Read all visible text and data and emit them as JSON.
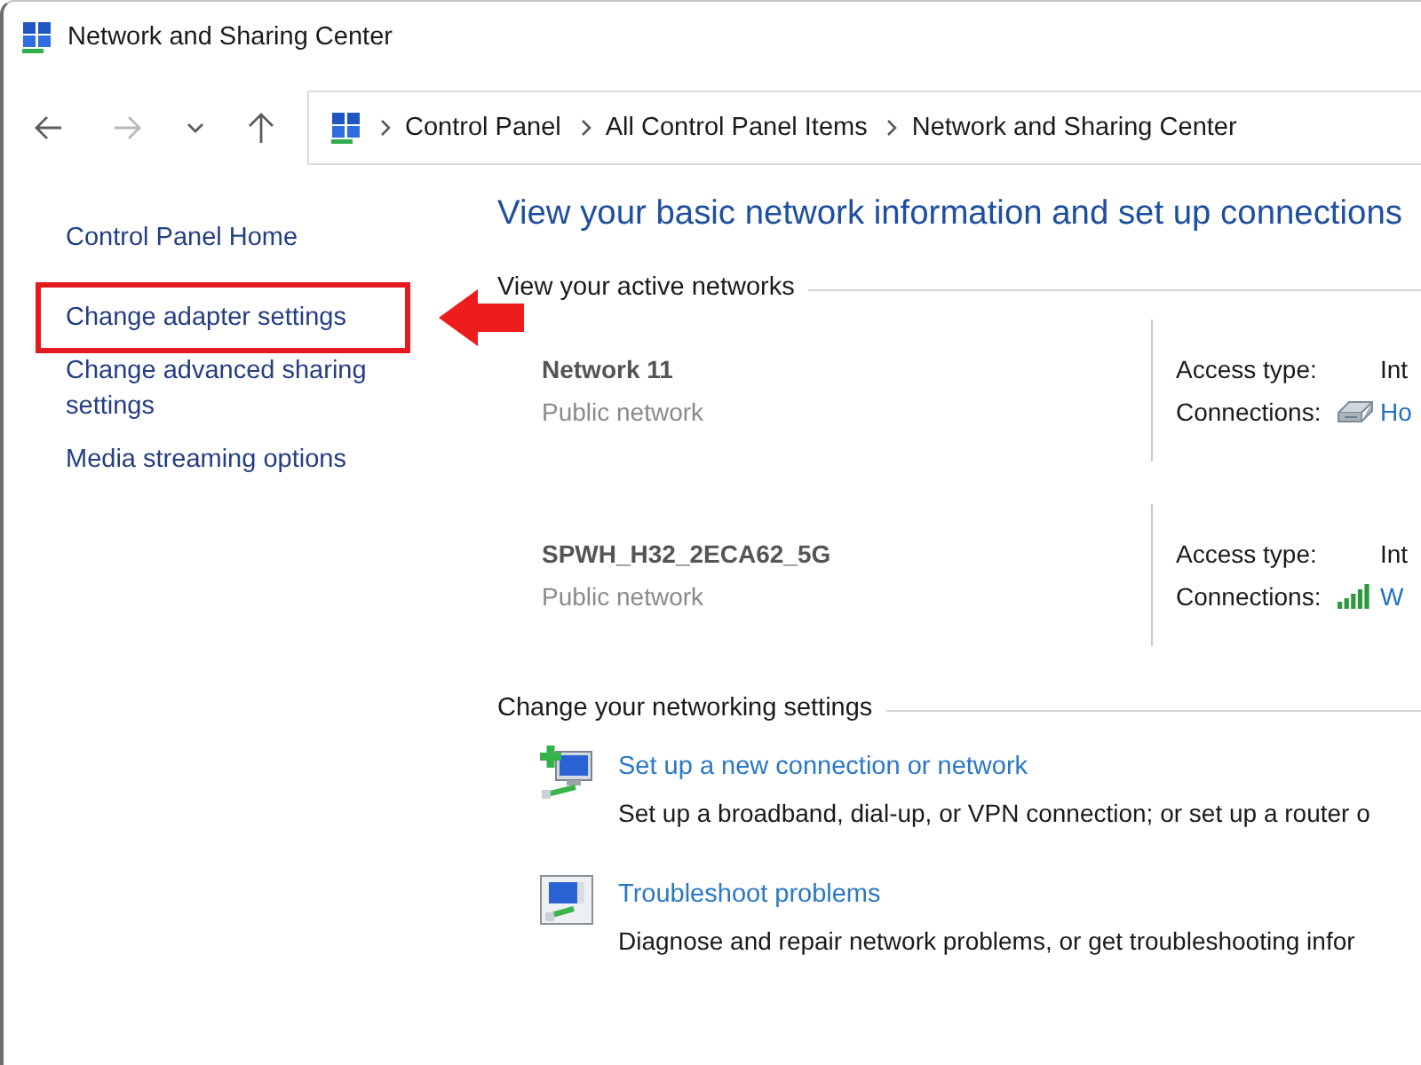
{
  "window": {
    "title": "Network and Sharing Center"
  },
  "navigation": {
    "buttons": [
      {
        "kind": "back",
        "disabled": false
      },
      {
        "kind": "forward",
        "disabled": true
      },
      {
        "kind": "recent",
        "disabled": false
      },
      {
        "kind": "up",
        "disabled": false
      }
    ],
    "breadcrumb": [
      "Control Panel",
      "All Control Panel Items",
      "Network and Sharing Center"
    ]
  },
  "sidebar": {
    "home": "Control Panel Home",
    "items": [
      {
        "label": "Change adapter settings",
        "highlighted": true
      },
      {
        "label": "Change advanced sharing settings",
        "highlighted": false
      },
      {
        "label": "Media streaming options",
        "highlighted": false
      }
    ]
  },
  "main": {
    "heading": "View your basic network information and set up connections",
    "active_networks": {
      "title": "View your active networks",
      "networks": [
        {
          "kind": "ethernet",
          "name": "Network 11",
          "category": "Public network",
          "access_type_label": "Access type:",
          "access_type": "Int",
          "connections_label": "Connections:",
          "connection": "Ho"
        },
        {
          "kind": "wifi",
          "name": "SPWH_H32_2ECA62_5G",
          "category": "Public network",
          "access_type_label": "Access type:",
          "access_type": "Int",
          "connections_label": "Connections:",
          "connection": "W"
        }
      ]
    },
    "settings": {
      "title": "Change your networking settings",
      "tasks": [
        {
          "kind": "new_connection",
          "link": "Set up a new connection or network",
          "description": "Set up a broadband, dial-up, or VPN connection; or set up a router o"
        },
        {
          "kind": "troubleshoot",
          "link": "Troubleshoot problems",
          "description": "Diagnose and repair network problems, or get troubleshooting infor"
        }
      ]
    }
  }
}
